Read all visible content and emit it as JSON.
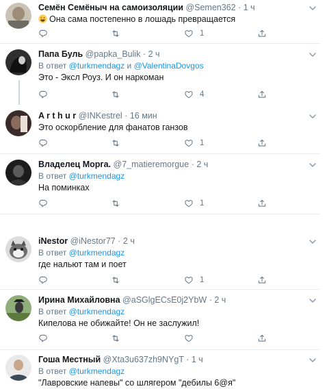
{
  "tweets": [
    {
      "name": "Семён Семёныч на самоизоляции",
      "handle": "@Semen362",
      "time": "1 ч",
      "reply_prefix": "",
      "mentions": [],
      "text": "Она сама постепенно в лошадь превращается",
      "has_emoji": true,
      "emoji_icon": "grinning-face-emoji",
      "replies": "",
      "retweets": "",
      "likes": "1"
    },
    {
      "name": "Папа Буль",
      "handle": "@papka_Bulik",
      "time": "2 ч",
      "reply_prefix": "В ответ",
      "mentions": [
        "@turkmendagz",
        "и",
        "@ValentinaDovgos"
      ],
      "text": "Это - Эксл Роуз. И он наркоман",
      "replies": "",
      "retweets": "",
      "likes": "4"
    },
    {
      "name": "A r t h u r",
      "handle": "@INKestrel",
      "time": "16 мин",
      "reply_prefix": "",
      "mentions": [],
      "text": "Это оскорбление для фанатов ганзов",
      "replies": "",
      "retweets": "",
      "likes": "1"
    },
    {
      "name": "Владелец Морга.",
      "handle": "@7_matieremorgue",
      "time": "2 ч",
      "reply_prefix": "В ответ",
      "mentions": [
        "@turkmendagz"
      ],
      "text": "На поминках",
      "replies": "",
      "retweets": "",
      "likes": "1"
    },
    {
      "name": "iNestor",
      "handle": "@iNestor77",
      "time": "2 ч",
      "reply_prefix": "В ответ",
      "mentions": [
        "@turkmendagz"
      ],
      "text": "где нальют там и поет",
      "replies": "",
      "retweets": "",
      "likes": "1"
    },
    {
      "name": "Ирина Михайловна",
      "handle": "@aSGlgECsE0j2YbW",
      "time": "2 ч",
      "reply_prefix": "В ответ",
      "mentions": [
        "@turkmendagz"
      ],
      "text": "Кипелова не обижайте! Он не заслужил!",
      "replies": "",
      "retweets": "",
      "likes": ""
    },
    {
      "name": "Гоша Местный",
      "handle": "@Xta3u637zh9NYgT",
      "time": "1 ч",
      "reply_prefix": "В ответ",
      "mentions": [
        "@turkmendagz"
      ],
      "text": "\"Лавровские напевы\" со шлягером \"дебилы 6@я\"",
      "replies": "",
      "retweets": "",
      "likes": ""
    }
  ],
  "separator": "·",
  "icons": {
    "reply": "reply-icon",
    "retweet": "retweet-icon",
    "like": "heart-icon",
    "share": "share-icon",
    "more": "chevron-down-icon"
  },
  "colors": {
    "name": "#14171a",
    "secondary": "#657786",
    "mention": "#1b95e0",
    "divider": "#e6ecf0",
    "thread_line": "#ccd6dd"
  }
}
